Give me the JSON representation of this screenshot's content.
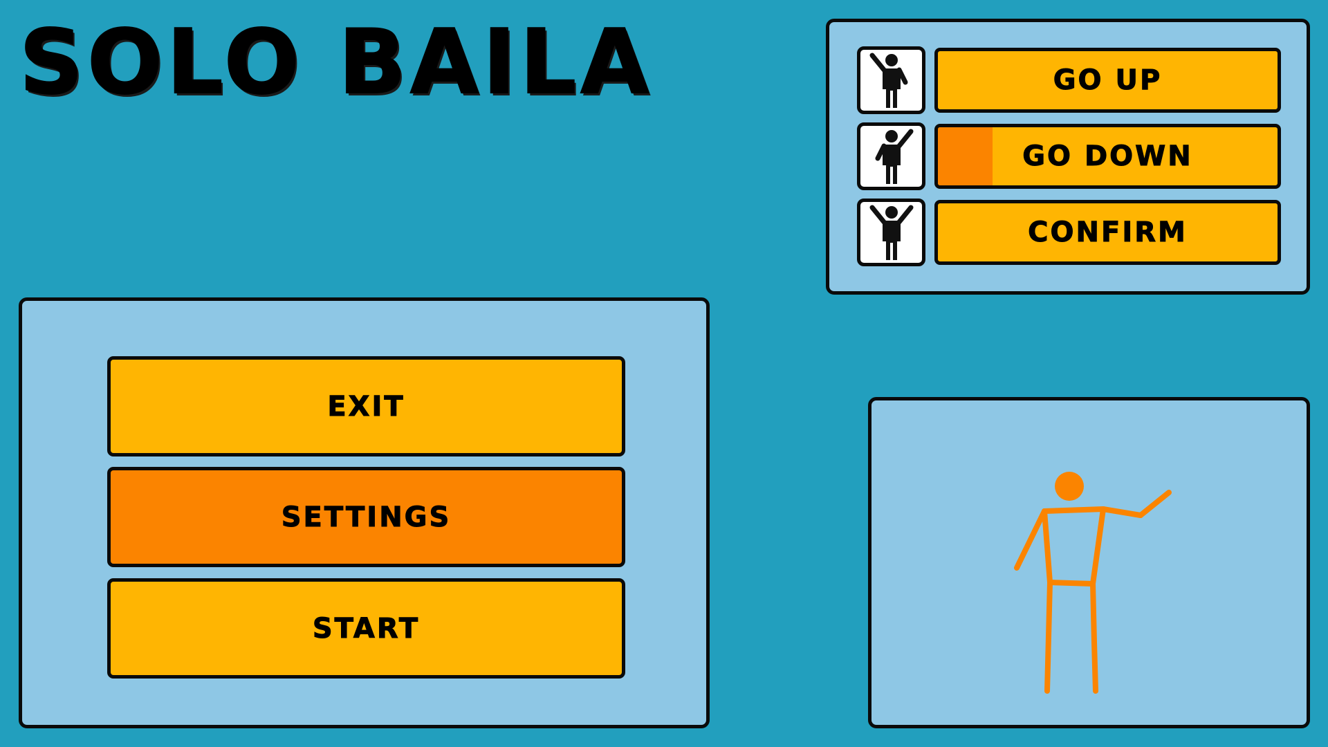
{
  "title": "SOLO BAILA",
  "menu": {
    "exit_label": "EXIT",
    "settings_label": "SETTINGS",
    "start_label": "START",
    "selected": "SETTINGS"
  },
  "controls": [
    {
      "label": "GO UP",
      "pose": "right-arm-raised-pose-icon",
      "progress": 0
    },
    {
      "label": "GO DOWN",
      "pose": "left-arm-raised-pose-icon",
      "progress": 0.16
    },
    {
      "label": "CONFIRM",
      "pose": "both-arms-raised-pose-icon",
      "progress": 0
    }
  ],
  "colors": {
    "background": "#229fbe",
    "panel": "#8ec7e5",
    "button": "#ffb502",
    "button_selected": "#fb8400",
    "avatar": "#fb8400"
  }
}
